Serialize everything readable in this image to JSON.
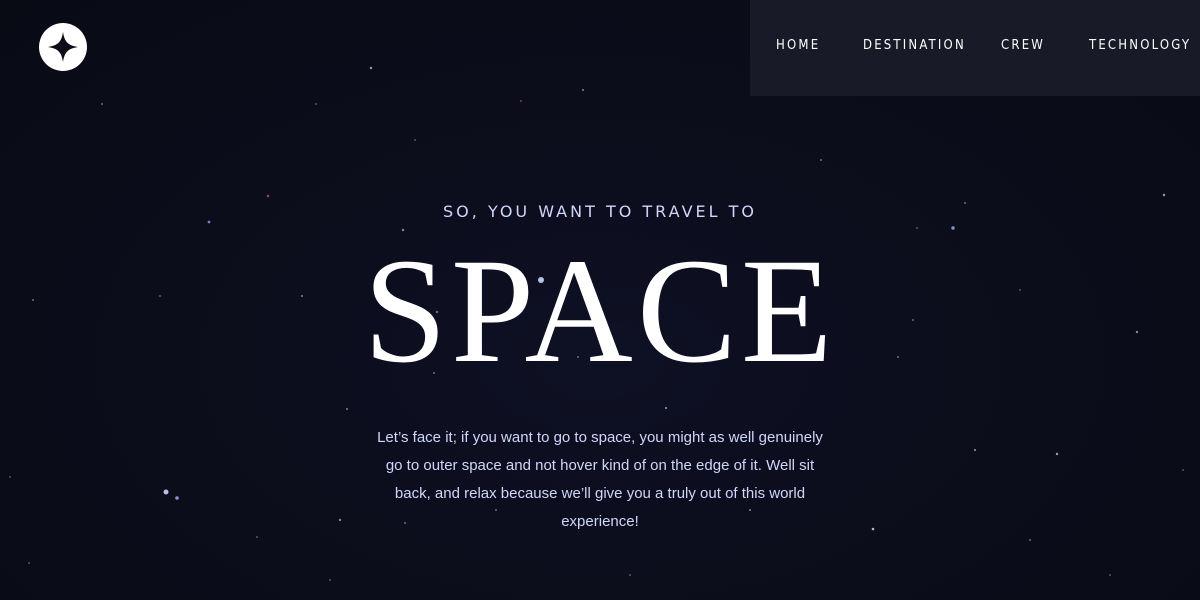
{
  "brand": {
    "logo_icon": "four-point-star-icon"
  },
  "nav": {
    "items": [
      {
        "label": "HOME"
      },
      {
        "label": "DESTINATION"
      },
      {
        "label": "CREW"
      },
      {
        "label": "TECHNOLOGY"
      }
    ]
  },
  "hero": {
    "eyebrow": "SO, YOU WANT TO TRAVEL TO",
    "title": "SPACE",
    "body": "Let’s face it; if you want to go to space, you might as well genuinely go to outer space and not hover kind of on the edge of it. Well sit back, and relax because we’ll give you a truly out of this world experience!"
  },
  "colors": {
    "background": "#0b0d17",
    "nav_background": "#181a27",
    "accent_text": "#d0d6f9",
    "white": "#ffffff"
  }
}
